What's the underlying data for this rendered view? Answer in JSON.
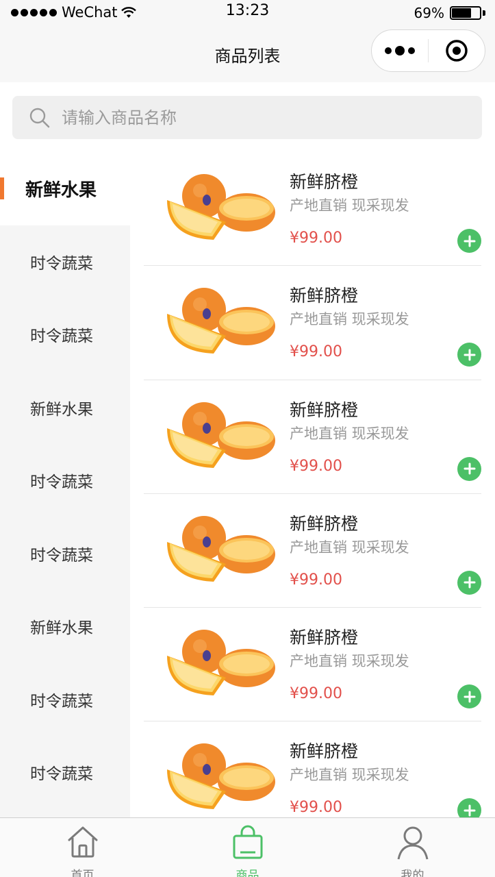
{
  "status_bar": {
    "carrier": "WeChat",
    "time": "13:23",
    "battery_percent": "69%",
    "battery_level": 0.69
  },
  "nav": {
    "title": "商品列表"
  },
  "search": {
    "placeholder": "请输入商品名称"
  },
  "sidebar": {
    "items": [
      {
        "label": "新鲜水果",
        "active": true
      },
      {
        "label": "时令蔬菜",
        "active": false
      },
      {
        "label": "时令蔬菜",
        "active": false
      },
      {
        "label": "新鲜水果",
        "active": false
      },
      {
        "label": "时令蔬菜",
        "active": false
      },
      {
        "label": "时令蔬菜",
        "active": false
      },
      {
        "label": "新鲜水果",
        "active": false
      },
      {
        "label": "时令蔬菜",
        "active": false
      },
      {
        "label": "时令蔬菜",
        "active": false
      }
    ]
  },
  "products": [
    {
      "name": "新鲜脐橙",
      "desc": "产地直销 现采现发",
      "price": "¥99.00",
      "image": "orange-image"
    },
    {
      "name": "新鲜脐橙",
      "desc": "产地直销 现采现发",
      "price": "¥99.00",
      "image": "orange-image"
    },
    {
      "name": "新鲜脐橙",
      "desc": "产地直销 现采现发",
      "price": "¥99.00",
      "image": "orange-image"
    },
    {
      "name": "新鲜脐橙",
      "desc": "产地直销 现采现发",
      "price": "¥99.00",
      "image": "orange-image"
    },
    {
      "name": "新鲜脐橙",
      "desc": "产地直销 现采现发",
      "price": "¥99.00",
      "image": "orange-image"
    },
    {
      "name": "新鲜脐橙",
      "desc": "产地直销 现采现发",
      "price": "¥99.00",
      "image": "orange-image"
    }
  ],
  "tab_bar": {
    "tabs": [
      {
        "label": "首页",
        "icon": "home-icon",
        "active": false
      },
      {
        "label": "商品",
        "icon": "shopping-bag-icon",
        "active": true
      },
      {
        "label": "我的",
        "icon": "user-icon",
        "active": false
      }
    ]
  },
  "colors": {
    "accent": "#4cc067",
    "price": "#e2504b",
    "indicator": "#f0782f"
  }
}
